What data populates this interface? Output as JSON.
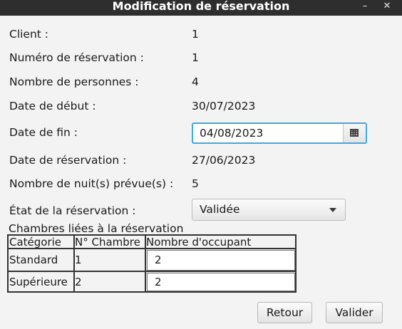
{
  "window": {
    "title": "Modification de réservation",
    "minimize_glyph": "–",
    "close_glyph": "✕"
  },
  "form": {
    "client": {
      "label": "Client :",
      "value": "1"
    },
    "reservation_number": {
      "label": "Numéro de réservation :",
      "value": "1"
    },
    "people_count": {
      "label": "Nombre de personnes :",
      "value": "4"
    },
    "start_date": {
      "label": "Date de début :",
      "value": "30/07/2023"
    },
    "end_date": {
      "label": "Date de fin :",
      "value": "04/08/2023",
      "icon": "calendar-icon"
    },
    "booking_date": {
      "label": "Date de réservation :",
      "value": "27/06/2023"
    },
    "nights": {
      "label": "Nombre de nuit(s) prévue(s) :",
      "value": "5"
    },
    "status": {
      "label": "État de la réservation :",
      "value": "Validée"
    }
  },
  "rooms": {
    "title": "Chambres liées à la réservation",
    "columns": [
      "Catégorie",
      "N° Chambre",
      "Nombre d'occupant"
    ],
    "rows": [
      {
        "category": "Standard",
        "room": "1",
        "occupants": "2"
      },
      {
        "category": "Supérieure",
        "room": "2",
        "occupants": "2"
      }
    ]
  },
  "buttons": {
    "back": "Retour",
    "validate": "Valider"
  }
}
